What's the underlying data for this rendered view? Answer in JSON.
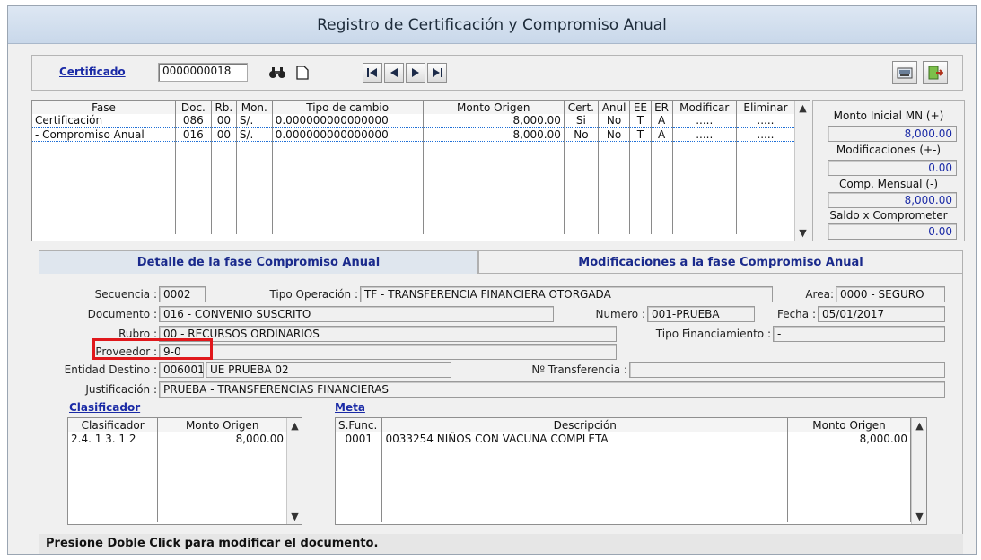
{
  "window": {
    "title": "Registro de Certificación y Compromiso Anual"
  },
  "topbar": {
    "certificado_label": "Certificado",
    "certificado_value": "0000000018"
  },
  "fases": {
    "headers": [
      "Fase",
      "Doc.",
      "Rb.",
      "Mon.",
      "Tipo de cambio",
      "Monto Origen",
      "Cert.",
      "Anul",
      "EE",
      "ER",
      "Modificar",
      "Eliminar"
    ],
    "rows": [
      [
        "Certificación",
        "086",
        "00",
        "S/.",
        "0.000000000000000",
        "8,000.00",
        "Si",
        "No",
        "T",
        "A",
        ".....",
        "....."
      ],
      [
        "- Compromiso Anual",
        "016",
        "00",
        "S/.",
        "0.000000000000000",
        "8,000.00",
        "No",
        "No",
        "T",
        "A",
        ".....",
        "....."
      ]
    ]
  },
  "summary": {
    "monto_inicial_label": "Monto Inicial MN (+)",
    "monto_inicial_value": "8,000.00",
    "modificaciones_label": "Modificaciones (+-)",
    "modificaciones_value": "0.00",
    "comp_mensual_label": "Comp. Mensual (-)",
    "comp_mensual_value": "8,000.00",
    "saldo_label": "Saldo x Comprometer",
    "saldo_value": "0.00"
  },
  "tabs": {
    "detalle": "Detalle de la fase Compromiso Anual",
    "modificaciones": "Modificaciones a la fase Compromiso Anual"
  },
  "detail": {
    "secuencia_label": "Secuencia :",
    "secuencia_value": "0002",
    "tipo_operacion_label": "Tipo Operación :",
    "tipo_operacion_value": "TF - TRANSFERENCIA FINANCIERA OTORGADA",
    "area_label": "Area:",
    "area_value": "0000 - SEGURO",
    "documento_label": "Documento :",
    "documento_value": "016 - CONVENIO SUSCRITO",
    "numero_label": "Numero :",
    "numero_value": "001-PRUEBA",
    "fecha_label": "Fecha :",
    "fecha_value": "05/01/2017",
    "rubro_label": "Rubro :",
    "rubro_value": "00 - RECURSOS ORDINARIOS",
    "tipo_fin_label": "Tipo Financiamiento :",
    "tipo_fin_value": "-",
    "proveedor_label": "Proveedor :",
    "proveedor_value": "9-0",
    "entidad_label": "Entidad Destino :",
    "entidad_code": "006001",
    "entidad_name": "UE PRUEBA 02",
    "transferencia_label": "Nº Transferencia :",
    "justificacion_label": "Justificación :",
    "justificacion_value": "PRUEBA - TRANSFERENCIAS FINANCIERAS"
  },
  "clasificador": {
    "title": "Clasificador",
    "headers": [
      "Clasificador",
      "Monto Origen"
    ],
    "rows": [
      [
        "2.4. 1 3. 1 2",
        "8,000.00"
      ]
    ]
  },
  "meta": {
    "title": "Meta",
    "headers": [
      "S.Func.",
      "Descripción",
      "Monto Origen"
    ],
    "rows": [
      [
        "0001",
        "0033254  NIÑOS CON VACUNA COMPLETA",
        "8,000.00"
      ]
    ]
  },
  "status": {
    "message": "Presione Doble Click para modificar el documento."
  },
  "colors": {
    "highlight": "#e0181c",
    "link": "#1a2aa6",
    "tab_text": "#1a2a8c"
  }
}
